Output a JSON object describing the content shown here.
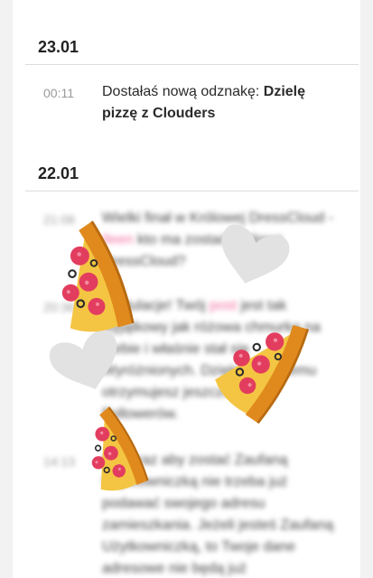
{
  "feed": {
    "sections": [
      {
        "date": "23.01",
        "items": [
          {
            "time": "00:11",
            "text_prefix": "Dostałaś nową odznakę: ",
            "text_bold": "Dzielę pizzę z Clouders"
          }
        ]
      },
      {
        "date": "22.01",
        "items": [
          {
            "time": "21:06",
            "text_a": "Wielki finał w Królowej DressCloud - ",
            "text_pink": "Ileen",
            "text_b": " kto ma zostać Królową DressCloud?"
          },
          {
            "time": "20:36",
            "text_a": "Gratulacje! Twój ",
            "text_pink": "post",
            "text_b": " jest tak wyjątkowy jak różowa chmurka na niebie i właśnie stał się Wyróżnionych. Dzięki ciekawemu otrzymujesz jeszcze więcej Followerów."
          },
          {
            "time": "14:13",
            "text_a": "Od teraz aby zostać Zaufaną Użytkowniczką nie trzeba już podawać swojego adresu zamieszkania. Jeżeli jesteś Zaufaną Użytkowniczką, to Twoje dane adresowe nie będą już"
          }
        ]
      }
    ]
  },
  "overlay_icons": [
    "pizza-icon",
    "pizza-icon",
    "pizza-icon",
    "heart-icon",
    "heart-icon"
  ],
  "colors": {
    "pink_accent": "#f26ea0",
    "background": "#f2f2f2",
    "card": "#ffffff",
    "divider": "#dcdcdc"
  }
}
